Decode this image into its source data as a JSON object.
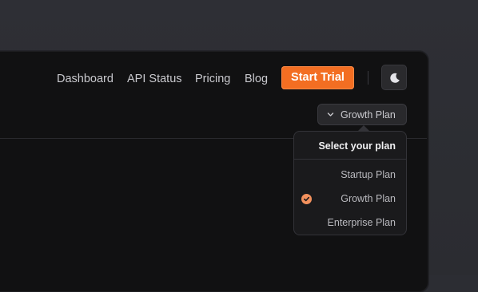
{
  "nav": {
    "links": [
      "Dashboard",
      "API Status",
      "Pricing",
      "Blog"
    ],
    "cta_label": "Start Trial",
    "theme_icon": "moon-icon"
  },
  "plan_selector": {
    "selected_label": "Growth Plan",
    "chevron_icon": "chevron-down-icon",
    "menu_title": "Select your plan",
    "options": [
      "Startup Plan",
      "Growth Plan",
      "Enterprise Plan"
    ],
    "selected_index": 1,
    "check_icon": "check-circle-icon"
  },
  "colors": {
    "accent": "#f36e22",
    "check": "#f3915d",
    "window_bg": "#111112",
    "page_bg": "#2c2d33"
  }
}
